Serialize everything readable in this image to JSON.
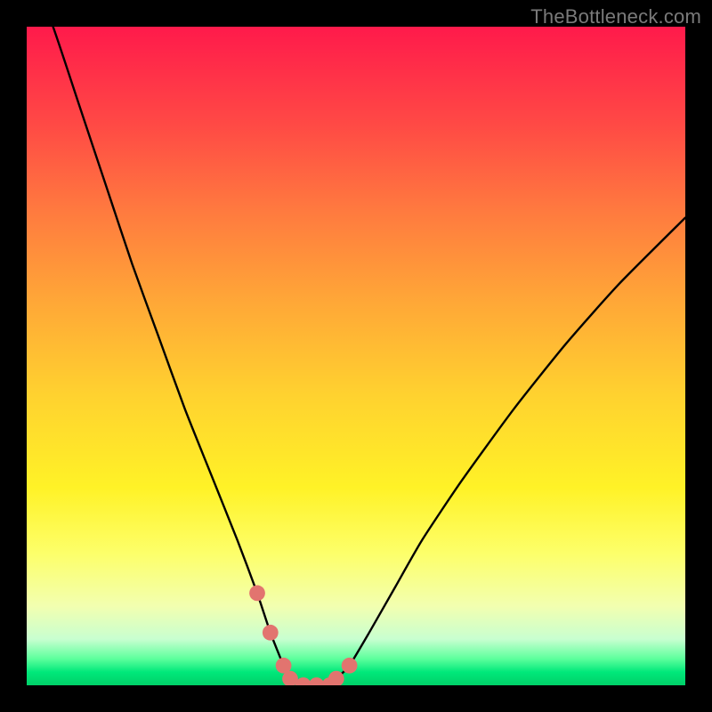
{
  "watermark": "TheBottleneck.com",
  "chart_data": {
    "type": "line",
    "title": "",
    "xlabel": "",
    "ylabel": "",
    "xlim": [
      0,
      100
    ],
    "ylim": [
      0,
      100
    ],
    "grid": false,
    "legend": false,
    "notes": "V-shaped bottleneck curve on a vertical red→green gradient. Y is bottleneck percentage (red=high, green=low). Minimum ≈0 at x≈40–47. Salmon dots mark the flat bottom.",
    "series": [
      {
        "name": "bottleneck-curve",
        "color": "#000000",
        "x": [
          0,
          4,
          8,
          12,
          16,
          20,
          24,
          28,
          32,
          35,
          37,
          39,
          40,
          42,
          44,
          46,
          47,
          49,
          52,
          56,
          60,
          66,
          74,
          82,
          90,
          100
        ],
        "values": [
          110,
          100,
          88,
          76,
          64,
          53,
          42,
          32,
          22,
          14,
          8,
          3,
          1,
          0,
          0,
          0,
          1,
          3,
          8,
          15,
          22,
          31,
          42,
          52,
          61,
          71
        ]
      }
    ],
    "markers": {
      "name": "bottom-dots",
      "color": "#e2746f",
      "radius_pct": 1.2,
      "x": [
        35,
        37,
        39,
        40,
        42,
        44,
        46,
        47,
        49
      ],
      "values": [
        14,
        8,
        3,
        1,
        0,
        0,
        0,
        1,
        3
      ]
    },
    "gradient_stops": [
      {
        "pct": 0,
        "color": "#ff1a4b"
      },
      {
        "pct": 15,
        "color": "#ff4a45"
      },
      {
        "pct": 28,
        "color": "#ff7a3f"
      },
      {
        "pct": 42,
        "color": "#ffa837"
      },
      {
        "pct": 56,
        "color": "#ffd22f"
      },
      {
        "pct": 70,
        "color": "#fff227"
      },
      {
        "pct": 80,
        "color": "#fdff6a"
      },
      {
        "pct": 88,
        "color": "#f2ffb0"
      },
      {
        "pct": 93,
        "color": "#c8ffd0"
      },
      {
        "pct": 96,
        "color": "#5cff9c"
      },
      {
        "pct": 98,
        "color": "#00e87a"
      },
      {
        "pct": 100,
        "color": "#00d068"
      }
    ]
  }
}
